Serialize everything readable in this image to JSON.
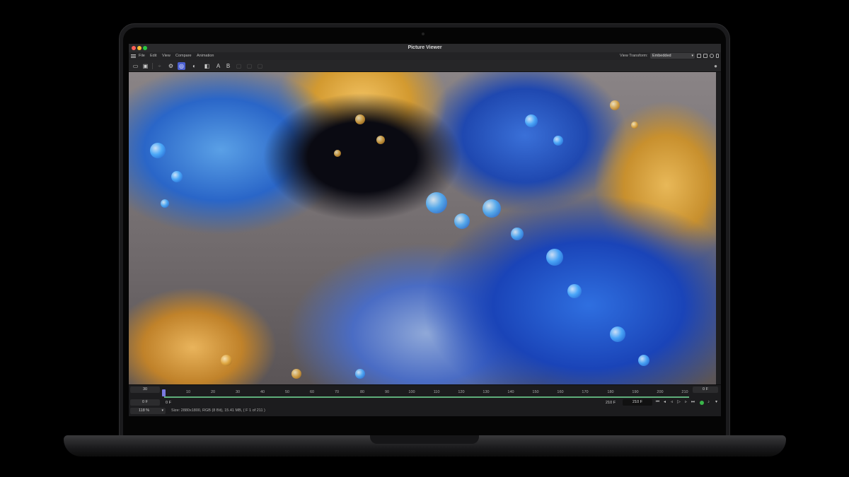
{
  "window": {
    "title": "Picture Viewer"
  },
  "menu": {
    "items": [
      "File",
      "Edit",
      "View",
      "Compare",
      "Animation"
    ]
  },
  "view_transform": {
    "label": "View Transform:",
    "value": "Embedded"
  },
  "toolbar": {
    "text_a": "A",
    "text_b": "B"
  },
  "timeline": {
    "fps": "30",
    "start_frame": "0 F",
    "end_frame": "0 F",
    "ticks": [
      "0",
      "10",
      "20",
      "30",
      "40",
      "50",
      "60",
      "70",
      "80",
      "90",
      "100",
      "110",
      "120",
      "130",
      "140",
      "150",
      "160",
      "170",
      "180",
      "190",
      "200",
      "210"
    ],
    "range_start": "0 F",
    "range_end": "210 F",
    "current_frame": "210 F",
    "zoom": "118 %",
    "status": "Size: 2880x1800, RGB (8 Bit), 15.41 MB,  ( F 1 of 211 )"
  },
  "colors": {
    "accent": "#4b5fd1",
    "range": "#5fae7a",
    "playing": "#3ab54a"
  }
}
